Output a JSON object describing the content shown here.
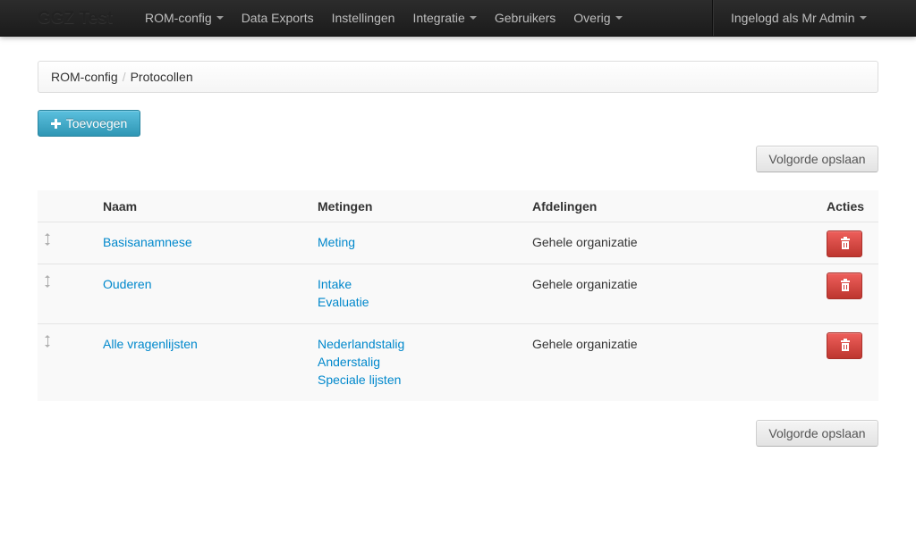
{
  "navbar": {
    "brand": "GGZ Test",
    "items": [
      {
        "label": "ROM-config",
        "dropdown": true
      },
      {
        "label": "Data Exports",
        "dropdown": false
      },
      {
        "label": "Instellingen",
        "dropdown": false
      },
      {
        "label": "Integratie",
        "dropdown": true
      },
      {
        "label": "Gebruikers",
        "dropdown": false
      },
      {
        "label": "Overig",
        "dropdown": true
      }
    ],
    "user_menu": "Ingelogd als Mr Admin"
  },
  "breadcrumb": {
    "parent": "ROM-config",
    "separator": "/",
    "current": "Protocollen"
  },
  "actions": {
    "add_label": "Toevoegen",
    "save_order_label": "Volgorde opslaan"
  },
  "table": {
    "headers": {
      "name": "Naam",
      "measurements": "Metingen",
      "departments": "Afdelingen",
      "actions": "Acties"
    },
    "rows": [
      {
        "name": "Basisanamnese",
        "measurements": [
          "Meting"
        ],
        "department": "Gehele organizatie"
      },
      {
        "name": "Ouderen",
        "measurements": [
          "Intake",
          "Evaluatie"
        ],
        "department": "Gehele organizatie"
      },
      {
        "name": "Alle vragenlijsten",
        "measurements": [
          "Nederlandstalig",
          "Anderstalig",
          "Speciale lijsten"
        ],
        "department": "Gehele organizatie"
      }
    ]
  },
  "icons": {
    "add": "plus-icon",
    "delete": "trash-icon",
    "drag": "drag-handle-icon",
    "dropdown": "caret-down-icon"
  },
  "colors": {
    "navbar": "#1b1b1b",
    "link": "#0088cc",
    "info_button": "#2f96b4",
    "danger_button": "#bd362f"
  }
}
